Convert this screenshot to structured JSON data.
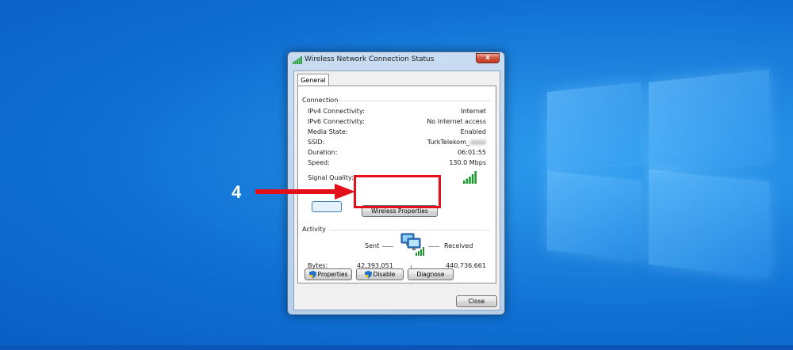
{
  "window": {
    "title": "Wireless Network Connection Status",
    "close_glyph": "x"
  },
  "tab": {
    "general": "General"
  },
  "connection": {
    "title": "Connection",
    "rows": [
      {
        "label": "IPv4 Connectivity:",
        "value": "Internet"
      },
      {
        "label": "IPv6 Connectivity:",
        "value": "No Internet access"
      },
      {
        "label": "Media State:",
        "value": "Enabled"
      },
      {
        "label": "SSID:",
        "value": "TurkTelekom_"
      },
      {
        "label": "Duration:",
        "value": "06:01:55"
      },
      {
        "label": "Speed:",
        "value": "130.0 Mbps"
      }
    ],
    "signal_quality_label": "Signal Quality:",
    "signal_level": 5,
    "signal_max": 5
  },
  "buttons": {
    "wireless_properties": "Wireless Properties",
    "properties": "Properties",
    "disable": "Disable",
    "diagnose": "Diagnose",
    "close": "Close"
  },
  "activity": {
    "title": "Activity",
    "sent_label": "Sent",
    "received_label": "Received",
    "bytes_label": "Bytes:",
    "bytes_sent": "42,393,051",
    "bytes_received": "440,736,661"
  },
  "annotation": {
    "step": "4"
  },
  "colors": {
    "annotation_red": "#e3101b",
    "signal_green": "#1e9a2f",
    "desktop_blue": "#1f86e0"
  }
}
